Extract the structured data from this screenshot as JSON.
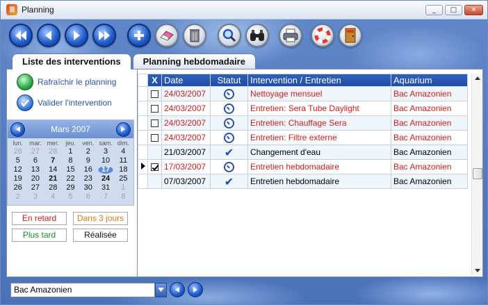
{
  "window": {
    "title": "Planning"
  },
  "window_controls": [
    "_",
    "□",
    "✕"
  ],
  "tabs": [
    {
      "label": "Liste des interventions",
      "active": true
    },
    {
      "label": "Planning hebdomadaire",
      "active": false
    }
  ],
  "actions": {
    "refresh_label": "Rafraîchir le planning",
    "validate_label": "Valider l'intervention"
  },
  "calendar": {
    "month_label": "Mars 2007",
    "day_names": [
      "lun.",
      "mar.",
      "mer.",
      "jeu.",
      "ven.",
      "sam.",
      "dim."
    ],
    "weeks": [
      [
        "26",
        "27",
        "28",
        "1",
        "2",
        "3",
        "4"
      ],
      [
        "5",
        "6",
        "7",
        "8",
        "9",
        "10",
        "11"
      ],
      [
        "12",
        "13",
        "14",
        "15",
        "16",
        "17",
        "18"
      ],
      [
        "19",
        "20",
        "21",
        "22",
        "23",
        "24",
        "25"
      ],
      [
        "26",
        "27",
        "28",
        "29",
        "30",
        "31",
        "1"
      ],
      [
        "2",
        "3",
        "4",
        "5",
        "6",
        "7",
        "8"
      ]
    ],
    "today": "17"
  },
  "legend": {
    "late": "En retard",
    "in3days": "Dans 3 jours",
    "later": "Plus tard",
    "done": "Réalisée"
  },
  "colors": {
    "late": "#cc1e1e",
    "in3days": "#e07a1a",
    "later": "#1a8a2a",
    "done": "#111111",
    "accent": "#1d4da6"
  },
  "table": {
    "headers": [
      "X",
      "Date",
      "Statut",
      "Intervention / Entretien",
      "Aquarium"
    ],
    "rows": [
      {
        "checked": false,
        "date": "24/03/2007",
        "status": "clock-icon",
        "intervention": "Nettoyage mensuel",
        "aquarium": "Bac Amazonien",
        "late": true
      },
      {
        "checked": false,
        "date": "24/03/2007",
        "status": "clock-icon",
        "intervention": "Entretien: Sera Tube Daylight",
        "aquarium": "Bac Amazonien",
        "late": true
      },
      {
        "checked": false,
        "date": "24/03/2007",
        "status": "clock-icon",
        "intervention": "Entretien: Chauffage Sera",
        "aquarium": "Bac Amazonien",
        "late": true
      },
      {
        "checked": false,
        "date": "24/03/2007",
        "status": "clock-icon",
        "intervention": "Entretien: Filtre externe",
        "aquarium": "Bac Amazonien",
        "late": true
      },
      {
        "checked": null,
        "date": "21/03/2007",
        "status": "check-icon",
        "intervention": "Changement d'eau",
        "aquarium": "Bac Amazonien",
        "late": false
      },
      {
        "checked": true,
        "date": "17/03/2007",
        "status": "clock-icon",
        "intervention": "Entretien hebdomadaire",
        "aquarium": "Bac Amazonien",
        "late": true,
        "current": true
      },
      {
        "checked": null,
        "date": "07/03/2007",
        "status": "check-icon",
        "intervention": "Entretien hebdomadaire",
        "aquarium": "Bac Amazonien",
        "late": false
      }
    ]
  },
  "aquarium_select": {
    "value": "Bac Amazonien"
  }
}
